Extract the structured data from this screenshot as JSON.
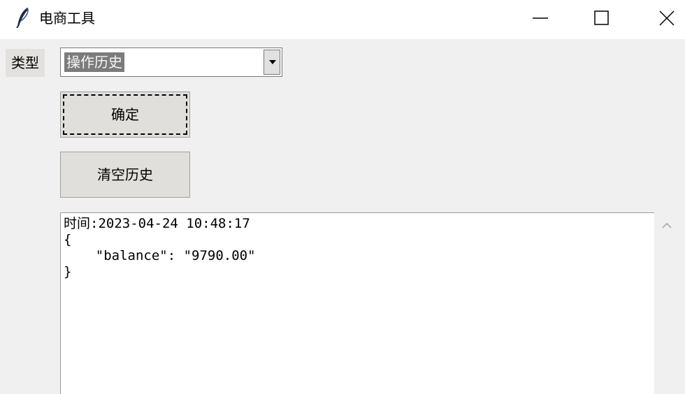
{
  "window": {
    "title": "电商工具",
    "icon": "feather-icon"
  },
  "controls": {
    "minimize": "minimize-icon",
    "maximize": "maximize-icon",
    "close": "close-icon"
  },
  "form": {
    "type_label": "类型",
    "type_selected": "操作历史",
    "confirm_label": "确定",
    "clear_history_label": "清空历史"
  },
  "output": {
    "lines": [
      "时间:2023-04-24 10:48:17",
      "{",
      "    \"balance\": \"9790.00\"",
      "}"
    ]
  }
}
